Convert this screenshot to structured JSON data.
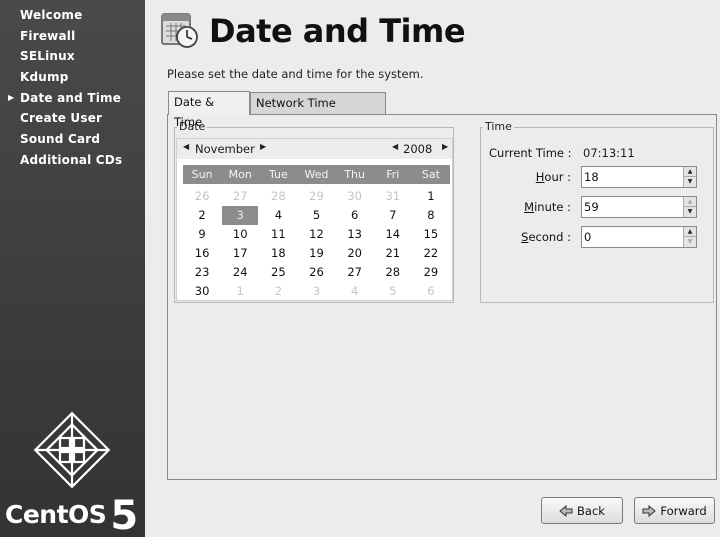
{
  "sidebar": {
    "items": [
      {
        "label": "Welcome",
        "current": false
      },
      {
        "label": "Firewall",
        "current": false
      },
      {
        "label": "SELinux",
        "current": false
      },
      {
        "label": "Kdump",
        "current": false
      },
      {
        "label": "Date and Time",
        "current": true
      },
      {
        "label": "Create User",
        "current": false
      },
      {
        "label": "Sound Card",
        "current": false
      },
      {
        "label": "Additional CDs",
        "current": false
      }
    ],
    "logo_text": "CentOS",
    "logo_num": "5"
  },
  "header": {
    "title": "Date and Time",
    "icon": "calendar-clock-icon"
  },
  "instruction": "Please set the date and time for the system.",
  "tabs": {
    "date_time": "Date & Time",
    "ntp": "Network Time Protocol"
  },
  "date_frame": {
    "label": "Date",
    "month": "November",
    "year": "2008",
    "weekdays": [
      "Sun",
      "Mon",
      "Tue",
      "Wed",
      "Thu",
      "Fri",
      "Sat"
    ],
    "days": [
      {
        "d": "26",
        "dim": true
      },
      {
        "d": "27",
        "dim": true
      },
      {
        "d": "28",
        "dim": true
      },
      {
        "d": "29",
        "dim": true
      },
      {
        "d": "30",
        "dim": true
      },
      {
        "d": "31",
        "dim": true
      },
      {
        "d": "1"
      },
      {
        "d": "2"
      },
      {
        "d": "3",
        "selected": true
      },
      {
        "d": "4"
      },
      {
        "d": "5"
      },
      {
        "d": "6"
      },
      {
        "d": "7"
      },
      {
        "d": "8"
      },
      {
        "d": "9"
      },
      {
        "d": "10"
      },
      {
        "d": "11"
      },
      {
        "d": "12"
      },
      {
        "d": "13"
      },
      {
        "d": "14"
      },
      {
        "d": "15"
      },
      {
        "d": "16"
      },
      {
        "d": "17"
      },
      {
        "d": "18"
      },
      {
        "d": "19"
      },
      {
        "d": "20"
      },
      {
        "d": "21"
      },
      {
        "d": "22"
      },
      {
        "d": "23"
      },
      {
        "d": "24"
      },
      {
        "d": "25"
      },
      {
        "d": "26"
      },
      {
        "d": "27"
      },
      {
        "d": "28"
      },
      {
        "d": "29"
      },
      {
        "d": "30"
      },
      {
        "d": "1",
        "dim": true
      },
      {
        "d": "2",
        "dim": true
      },
      {
        "d": "3",
        "dim": true
      },
      {
        "d": "4",
        "dim": true
      },
      {
        "d": "5",
        "dim": true
      },
      {
        "d": "6",
        "dim": true
      }
    ]
  },
  "time_frame": {
    "label": "Time",
    "current_time_label": "Current Time :",
    "current_time_value": "07:13:11",
    "hour_label": "Hour :",
    "hour_value": "18",
    "minute_label": "Minute :",
    "minute_value": "59",
    "second_label": "Second :",
    "second_value": "0"
  },
  "buttons": {
    "back": "Back",
    "forward": "Forward"
  },
  "colors": {
    "sidebar_bg": "#3c3c3c",
    "selected_day": "#8c8c8c",
    "weekday_bar": "#8c8c8c"
  }
}
